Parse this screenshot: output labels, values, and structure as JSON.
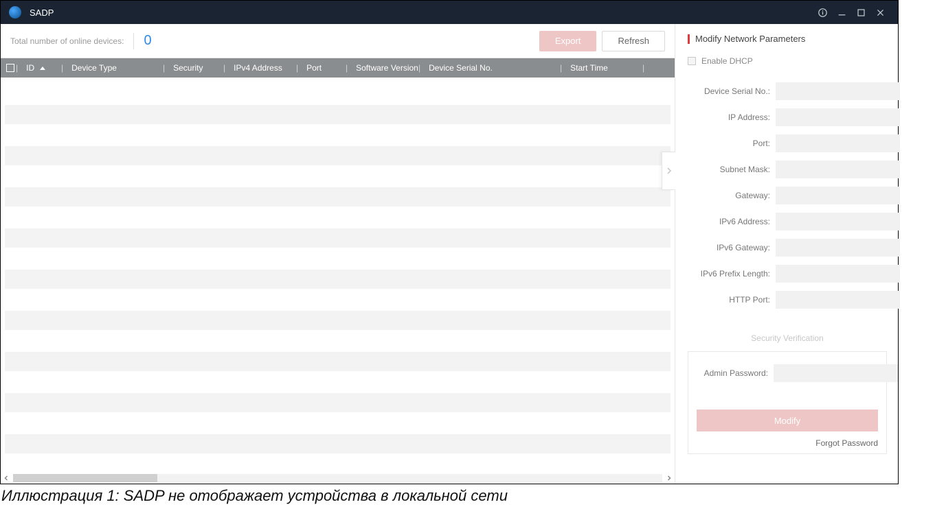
{
  "titlebar": {
    "app_name": "SADP"
  },
  "toolbar": {
    "total_label": "Total number of online devices:",
    "count": "0",
    "export_label": "Export",
    "refresh_label": "Refresh"
  },
  "table": {
    "columns": {
      "id": "ID",
      "type": "Device Type",
      "security": "Security",
      "ipv4": "IPv4 Address",
      "port": "Port",
      "software": "Software Version",
      "serial": "Device Serial No.",
      "start": "Start Time"
    }
  },
  "side": {
    "title": "Modify Network Parameters",
    "dhcp": "Enable DHCP",
    "fields": {
      "serial": "Device Serial No.:",
      "ip": "IP Address:",
      "port": "Port:",
      "subnet": "Subnet Mask:",
      "gateway": "Gateway:",
      "ipv6": "IPv6 Address:",
      "ipv6gw": "IPv6 Gateway:",
      "ipv6len": "IPv6 Prefix Length:",
      "http": "HTTP Port:"
    },
    "sec_ver": "Security Verification",
    "admin_pw": "Admin Password:",
    "modify": "Modify",
    "forgot": "Forgot Password"
  },
  "caption": "Иллюстрация 1: SADP не отображает устройства в локальной сети"
}
